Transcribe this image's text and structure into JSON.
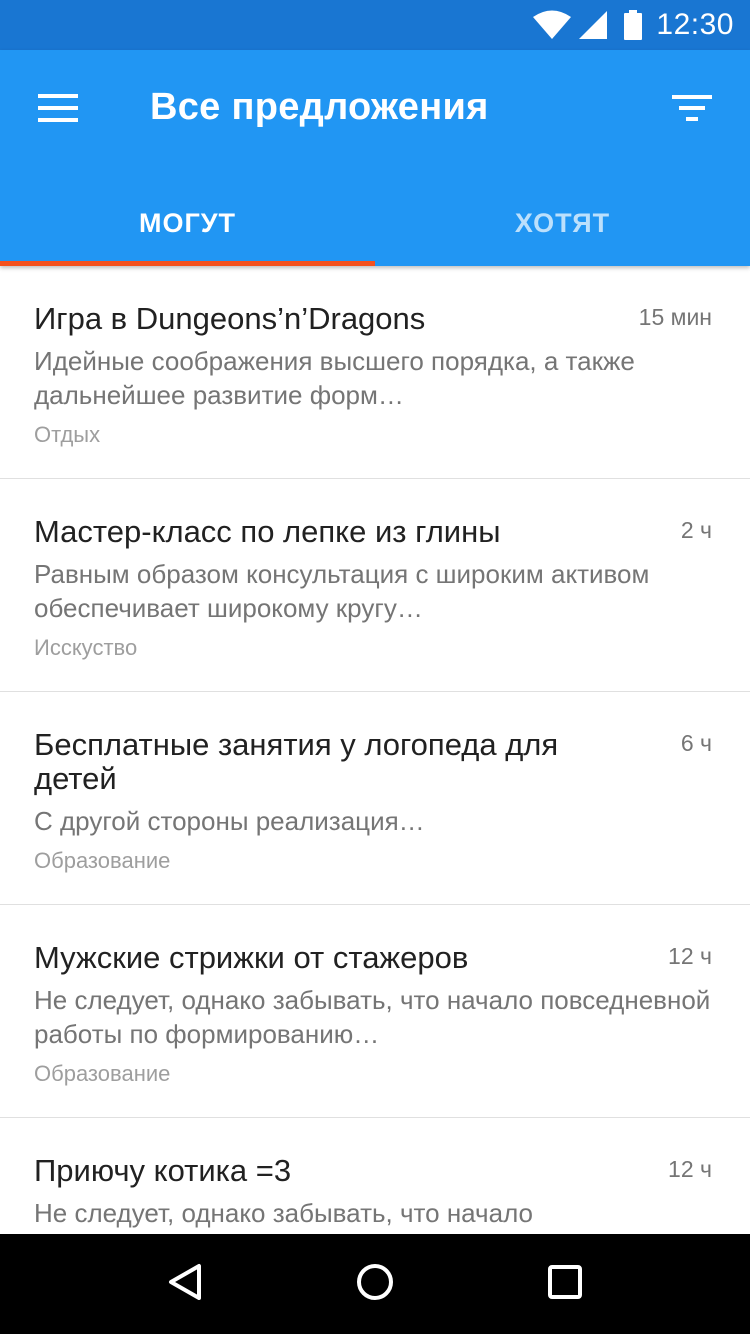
{
  "status_bar": {
    "time": "12:30",
    "icons": [
      "wifi-icon",
      "signal-icon",
      "battery-icon"
    ]
  },
  "app_bar": {
    "title": "Все предложения",
    "menu_icon": "hamburger-menu-icon",
    "filter_icon": "filter-icon",
    "background_color": "#2196F3",
    "status_color": "#1976D2",
    "indicator_color": "#F4511E"
  },
  "tabs": [
    {
      "label": "МОГУТ",
      "active": true
    },
    {
      "label": "ХОТЯТ",
      "active": false
    }
  ],
  "items": [
    {
      "title": "Игра в Dungeons’n’Dragons",
      "time": "15 мин",
      "description": "Идейные соображения высшего порядка, а также дальнейшее развитие форм…",
      "category": "Отдых"
    },
    {
      "title": "Мастер-класс по лепке из глины",
      "time": "2 ч",
      "description": "Равным образом консультация с широким активом обеспечивает широкому кругу…",
      "category": "Исскуство"
    },
    {
      "title": "Бесплатные занятия у логопеда для детей",
      "time": "6 ч",
      "description": "С другой стороны реализация…",
      "category": "Образование"
    },
    {
      "title": "Мужские стрижки от стажеров",
      "time": "12 ч",
      "description": "Не следует, однако забывать, что начало повседневной работы по формированию…",
      "category": "Образование"
    },
    {
      "title": "Приючу котика =3",
      "time": "12 ч",
      "description": "Не следует, однако забывать, что начало",
      "category": ""
    }
  ],
  "nav_bar": {
    "icons": [
      "back-icon",
      "home-icon",
      "recents-icon"
    ]
  }
}
